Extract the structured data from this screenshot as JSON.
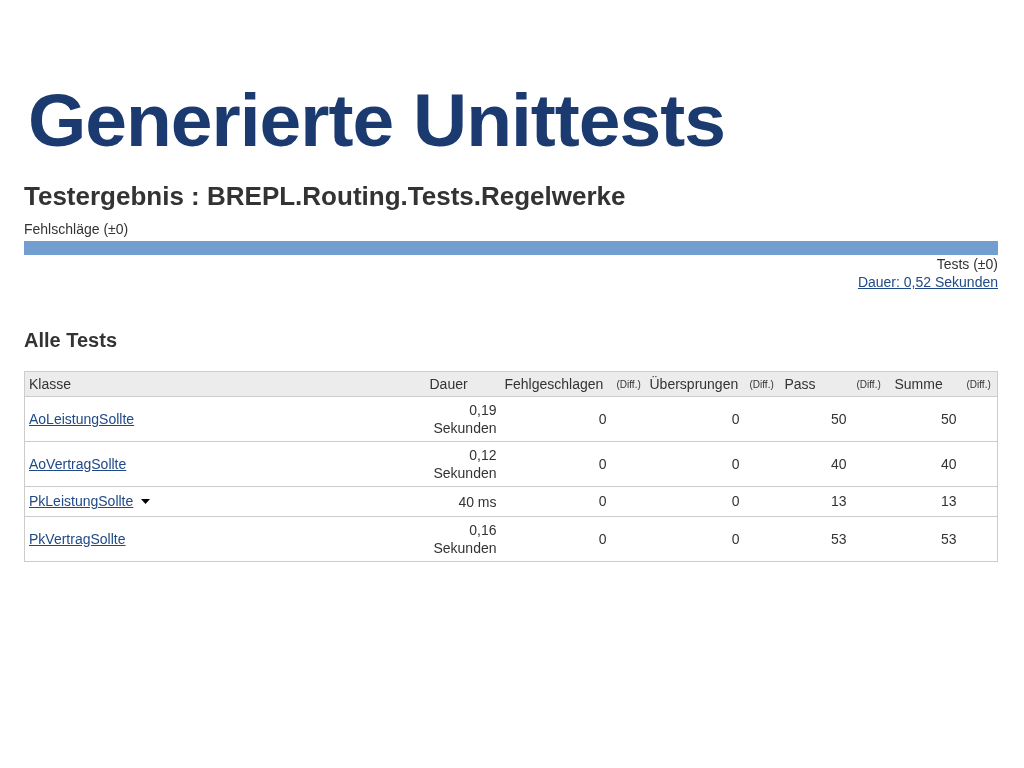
{
  "slide_title": "Generierte Unittests",
  "page": {
    "heading": "Testergebnis : BREPL.Routing.Tests.Regelwerke",
    "failures_label": "Fehlschläge (±0)",
    "progress": {
      "level": 1
    },
    "tests_label": "Tests (±0)",
    "duration_link": "Dauer: 0,52 Sekunden",
    "section_title": "Alle Tests",
    "table": {
      "columns": [
        {
          "label": "Klasse",
          "kind": "main"
        },
        {
          "label": "Dauer",
          "kind": "main"
        },
        {
          "label": "Fehlgeschlagen",
          "kind": "main"
        },
        {
          "label": "(Diff.)",
          "kind": "diff"
        },
        {
          "label": "Übersprungen",
          "kind": "main"
        },
        {
          "label": "(Diff.)",
          "kind": "diff"
        },
        {
          "label": "Pass",
          "kind": "main"
        },
        {
          "label": "(Diff.)",
          "kind": "diff"
        },
        {
          "label": "Summe",
          "kind": "main"
        },
        {
          "label": "(Diff.)",
          "kind": "diff"
        }
      ],
      "rows": [
        {
          "class": "AoLeistungSollte",
          "menu": false,
          "duration": [
            "0,19",
            "Sekunden"
          ],
          "failed": "0",
          "skipped": "0",
          "pass": "50",
          "total": "50"
        },
        {
          "class": "AoVertragSollte",
          "menu": false,
          "duration": [
            "0,12",
            "Sekunden"
          ],
          "failed": "0",
          "skipped": "0",
          "pass": "40",
          "total": "40"
        },
        {
          "class": "PkLeistungSollte",
          "menu": true,
          "duration": [
            "40 ms"
          ],
          "failed": "0",
          "skipped": "0",
          "pass": "13",
          "total": "13"
        },
        {
          "class": "PkVertragSollte",
          "menu": false,
          "duration": [
            "0,16",
            "Sekunden"
          ],
          "failed": "0",
          "skipped": "0",
          "pass": "53",
          "total": "53"
        }
      ]
    }
  }
}
